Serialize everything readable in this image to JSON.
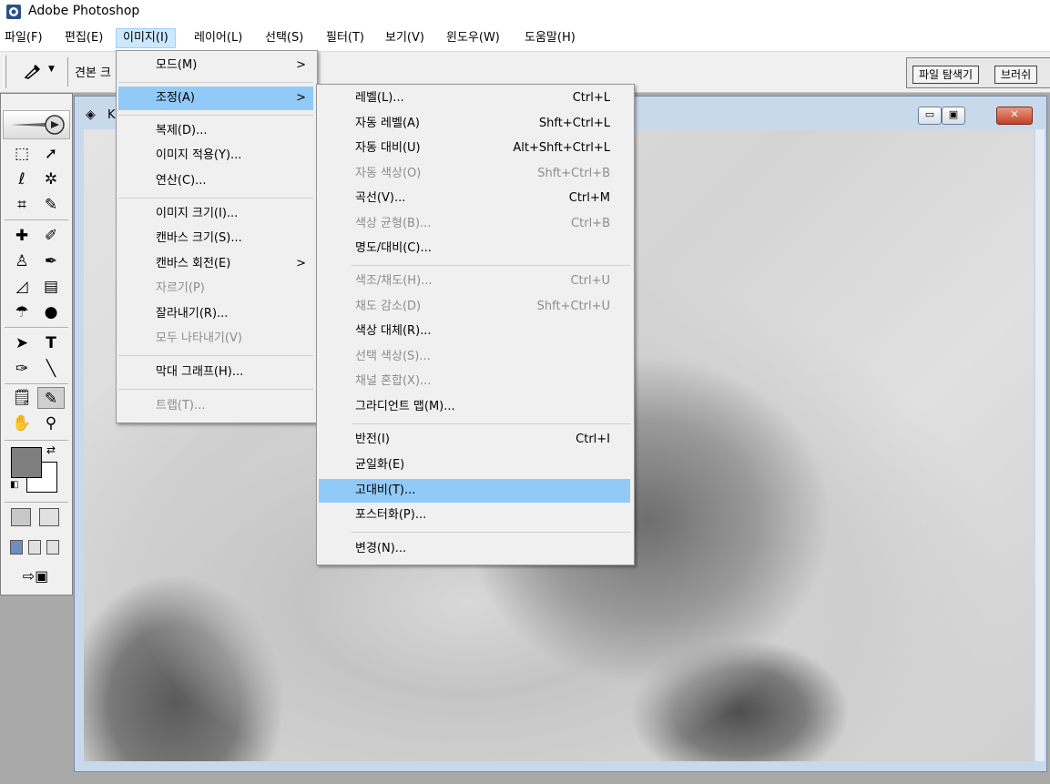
{
  "app": {
    "title": "Adobe Photoshop"
  },
  "menubar": {
    "items": [
      "파일(F)",
      "편집(E)",
      "이미지(I)",
      "레이어(L)",
      "선택(S)",
      "필터(T)",
      "보기(V)",
      "윈도우(W)",
      "도움말(H)"
    ],
    "active_index": 2
  },
  "options": {
    "sample_label": "견본 크"
  },
  "palette_well": {
    "tabs": [
      "파일 탐색기",
      "브러쉬"
    ]
  },
  "document": {
    "title": "K",
    "buttons": [
      "minimize-icon",
      "maximize-icon",
      "close-icon"
    ]
  },
  "image_menu": {
    "items": [
      {
        "label": "모드(M)",
        "submenu": true,
        "enabled": true
      },
      {
        "label": "조정(A)",
        "submenu": true,
        "enabled": true,
        "highlighted": true
      },
      {
        "label": "복제(D)...",
        "enabled": true
      },
      {
        "label": "이미지 적용(Y)...",
        "enabled": true
      },
      {
        "label": "연산(C)...",
        "enabled": true
      },
      {
        "label": "이미지 크기(I)...",
        "enabled": true
      },
      {
        "label": "캔바스 크기(S)...",
        "enabled": true
      },
      {
        "label": "캔바스 회전(E)",
        "submenu": true,
        "enabled": true
      },
      {
        "label": "자르기(P)",
        "enabled": false
      },
      {
        "label": "잘라내기(R)...",
        "enabled": true
      },
      {
        "label": "모두 나타내기(V)",
        "enabled": false
      },
      {
        "label": "막대 그래프(H)...",
        "enabled": true
      },
      {
        "label": "트랩(T)...",
        "enabled": false
      }
    ],
    "submenu_glyph": ">"
  },
  "adjust_menu": {
    "items": [
      {
        "label": "레벨(L)...",
        "shortcut": "Ctrl+L",
        "enabled": true
      },
      {
        "label": "자동 레벨(A)",
        "shortcut": "Shft+Ctrl+L",
        "enabled": true
      },
      {
        "label": "자동 대비(U)",
        "shortcut": "Alt+Shft+Ctrl+L",
        "enabled": true
      },
      {
        "label": "자동 색상(O)",
        "shortcut": "Shft+Ctrl+B",
        "enabled": false
      },
      {
        "label": "곡선(V)...",
        "shortcut": "Ctrl+M",
        "enabled": true
      },
      {
        "label": "색상 균형(B)...",
        "shortcut": "Ctrl+B",
        "enabled": false
      },
      {
        "label": "명도/대비(C)...",
        "shortcut": "",
        "enabled": true
      },
      {
        "label": "색조/채도(H)...",
        "shortcut": "Ctrl+U",
        "enabled": false
      },
      {
        "label": "채도 감소(D)",
        "shortcut": "Shft+Ctrl+U",
        "enabled": false
      },
      {
        "label": "색상 대체(R)...",
        "shortcut": "",
        "enabled": true
      },
      {
        "label": "선택 색상(S)...",
        "shortcut": "",
        "enabled": false
      },
      {
        "label": "채널 혼합(X)...",
        "shortcut": "",
        "enabled": false
      },
      {
        "label": "그라디언트 맵(M)...",
        "shortcut": "",
        "enabled": true
      },
      {
        "label": "반전(I)",
        "shortcut": "Ctrl+I",
        "enabled": true
      },
      {
        "label": "균일화(E)",
        "shortcut": "",
        "enabled": true
      },
      {
        "label": "고대비(T)...",
        "shortcut": "",
        "enabled": true,
        "highlighted": true
      },
      {
        "label": "포스터화(P)...",
        "shortcut": "",
        "enabled": true
      },
      {
        "label": "변경(N)...",
        "shortcut": "",
        "enabled": true
      }
    ]
  },
  "toolbox": {
    "tools": [
      "marquee-tool-icon",
      "move-tool-icon",
      "lasso-tool-icon",
      "magic-wand-tool-icon",
      "crop-tool-icon",
      "slice-tool-icon",
      "healing-brush-tool-icon",
      "brush-tool-icon",
      "clone-stamp-tool-icon",
      "history-brush-tool-icon",
      "eraser-tool-icon",
      "gradient-tool-icon",
      "blur-tool-icon",
      "dodge-tool-icon",
      "path-selection-tool-icon",
      "type-tool-icon",
      "pen-tool-icon",
      "line-tool-icon",
      "notes-tool-icon",
      "eyedropper-tool-icon",
      "hand-tool-icon",
      "zoom-tool-icon"
    ],
    "selected_tool": "eyedropper-tool-icon",
    "foreground_color": "#7f7f7f",
    "background_color": "#ffffff"
  },
  "colors": {
    "menu_highlight": "#91c9f7",
    "menu_active": "#cce8ff",
    "disabled_text": "#8d8d8d"
  }
}
